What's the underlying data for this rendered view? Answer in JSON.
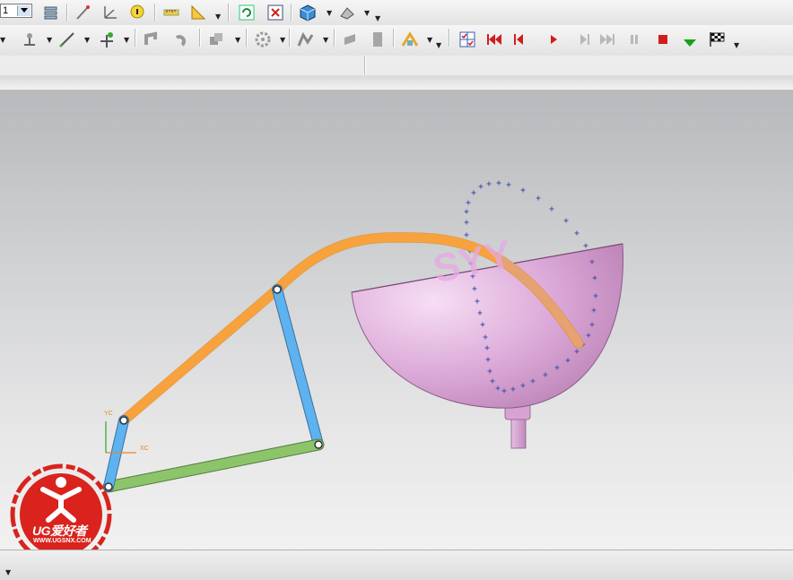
{
  "toolbar": {
    "layer_value": "1"
  },
  "viewport": {
    "watermark_text": "SYY",
    "axis_labels": {
      "y": "YC",
      "x": "XC"
    }
  },
  "watermark": {
    "title": "UG爱好者",
    "url": "WWW.UGSNX.COM"
  },
  "colors": {
    "coupler": "#f7a23c",
    "rocker": "#5db3f0",
    "ground_link": "#8cc46a",
    "crank": "#5db3f0",
    "bowl": "#e2b3e0",
    "trace": "#3e4fa8",
    "watermark_red": "#d9231c",
    "play": "#d11d1d",
    "step_green": "#13a313"
  },
  "icons": [
    "layer-settings-icon",
    "point-icon",
    "datum-csys-icon",
    "info-icon",
    "measure-distance-icon",
    "measure-angle-icon",
    "refresh-icon",
    "fit-view-icon",
    "shaded-cube-icon",
    "surface-shade-icon",
    "motion-joint-icon",
    "line-icon",
    "point-add-icon",
    "link-icon",
    "spring-icon",
    "solid-box-icon",
    "gear-icon",
    "curve-icon",
    "sheet-icon",
    "page-icon",
    "assembly-icon",
    "animation-settings-icon",
    "rewind-start-icon",
    "step-back-icon",
    "play-icon",
    "step-forward-icon",
    "fast-forward-icon",
    "pause-icon",
    "stop-icon",
    "green-step-icon",
    "finish-flag-icon"
  ]
}
